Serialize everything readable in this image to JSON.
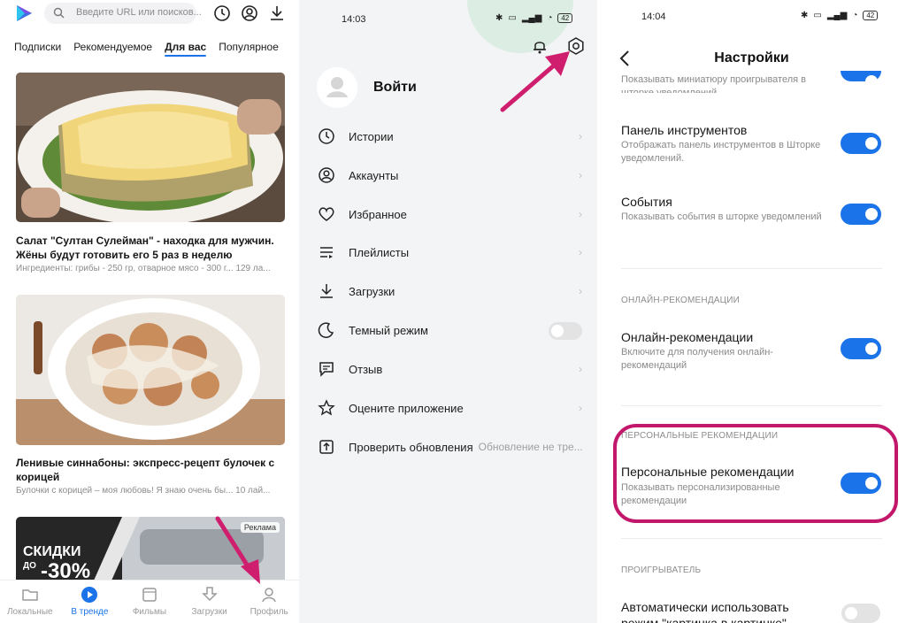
{
  "panel1": {
    "search_placeholder": "Введите URL или поисков...",
    "tabs": [
      {
        "label": "Подписки"
      },
      {
        "label": "Рекомендуемое"
      },
      {
        "label": "Для вас"
      },
      {
        "label": "Популярное"
      }
    ],
    "cards": [
      {
        "title": "Салат \"Султан Сулейман\" - находка для мужчин. Жёны будут готовить его 5 раз в неделю",
        "subtitle": "Ингредиенты: грибы - 250 гр, отварное мясо - 300 г... 129 ла..."
      },
      {
        "title": "Ленивые синнабоны: экспресс-рецепт булочек с корицей",
        "subtitle": "Булочки с корицей – моя любовь! Я знаю очень бы... 10 лай..."
      }
    ],
    "ad": {
      "line1": "СКИДКИ",
      "line2": "ДО",
      "line3": "-30%",
      "badge": "Реклама"
    },
    "bottom_nav": [
      {
        "label": "Локальные",
        "icon": "folder-icon"
      },
      {
        "label": "В тренде",
        "icon": "play-circle-icon"
      },
      {
        "label": "Фильмы",
        "icon": "film-icon"
      },
      {
        "label": "Загрузки",
        "icon": "download-icon"
      },
      {
        "label": "Профиль",
        "icon": "person-icon"
      }
    ],
    "accent_color": "#1a73e8"
  },
  "panel2": {
    "time": "14:03",
    "battery": "42",
    "login_label": "Войти",
    "menu": [
      {
        "label": "Истории",
        "icon": "history-icon",
        "value": ""
      },
      {
        "label": "Аккаунты",
        "icon": "account-icon",
        "value": ""
      },
      {
        "label": "Избранное",
        "icon": "heart-icon",
        "value": ""
      },
      {
        "label": "Плейлисты",
        "icon": "playlist-icon",
        "value": ""
      },
      {
        "label": "Загрузки",
        "icon": "download-icon",
        "value": ""
      },
      {
        "label": "Темный режим",
        "icon": "moon-icon",
        "value": ""
      },
      {
        "label": "Отзыв",
        "icon": "feedback-icon",
        "value": ""
      },
      {
        "label": "Оцените приложение",
        "icon": "star-icon",
        "value": ""
      },
      {
        "label": "Проверить обновления",
        "icon": "update-icon",
        "value": "Обновление не тре..."
      }
    ]
  },
  "panel3": {
    "time": "14:04",
    "battery": "42",
    "title": "Настройки",
    "top_cut_desc": "Показывать миниатюру проигрывателя в шторке уведомлений",
    "items": [
      {
        "title": "Панель инструментов",
        "desc": "Отображать панель инструментов в Шторке уведомлений.",
        "enabled": true
      },
      {
        "title": "События",
        "desc": "Показывать события в шторке уведомлений",
        "enabled": true
      }
    ],
    "section_online": "ОНЛАЙН-РЕКОМЕНДАЦИИ",
    "online": {
      "title": "Онлайн-рекомендации",
      "desc": "Включите для получения онлайн-рекомендаций",
      "enabled": true
    },
    "section_personal": "ПЕРСОНАЛЬНЫЕ РЕКОМЕНДАЦИИ",
    "personal": {
      "title": "Персональные рекомендации",
      "desc": "Показывать персонализированные рекомендации",
      "enabled": true
    },
    "section_player": "ПРОИГРЫВАТЕЛЬ",
    "player": {
      "title": "Автоматически использовать",
      "desc": "режим \"картинка в картинке\"",
      "enabled": false
    },
    "toggle_on_color": "#1a73e8",
    "highlight_color": "#c2176b"
  }
}
